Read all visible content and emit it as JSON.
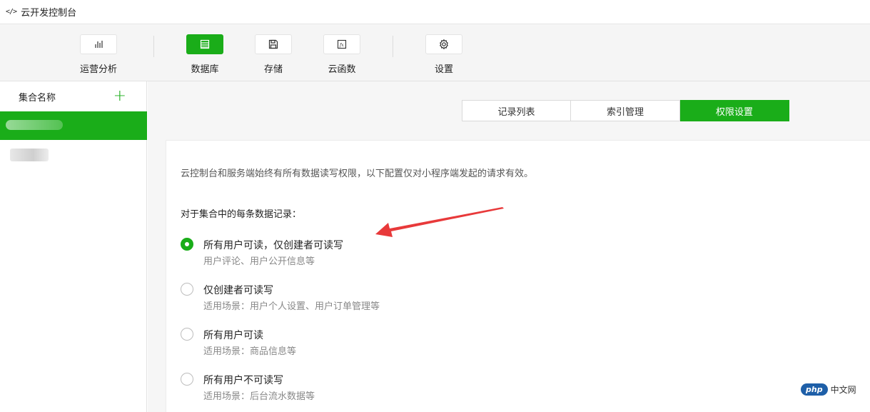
{
  "window": {
    "title": "云开发控制台"
  },
  "toolbar": {
    "items": [
      {
        "label": "运营分析",
        "icon": "bar-chart-icon"
      },
      {
        "label": "数据库",
        "icon": "database-icon",
        "active": true
      },
      {
        "label": "存储",
        "icon": "floppy-disk-icon"
      },
      {
        "label": "云函数",
        "icon": "function-icon"
      },
      {
        "label": "设置",
        "icon": "gear-icon"
      }
    ]
  },
  "sidebar": {
    "header": "集合名称",
    "add": "+"
  },
  "tabs": [
    {
      "label": "记录列表"
    },
    {
      "label": "索引管理"
    },
    {
      "label": "权限设置",
      "active": true
    }
  ],
  "permissions": {
    "description": "云控制台和服务端始终有所有数据读写权限，以下配置仅对小程序端发起的请求有效。",
    "lead": "对于集合中的每条数据记录：",
    "options": [
      {
        "label": "所有用户可读，仅创建者可读写",
        "sub": "用户评论、用户公开信息等",
        "checked": true
      },
      {
        "label": "仅创建者可读写",
        "sub": "适用场景：用户个人设置、用户订单管理等"
      },
      {
        "label": "所有用户可读",
        "sub": "适用场景：商品信息等"
      },
      {
        "label": "所有用户不可读写",
        "sub": "适用场景：后台流水数据等"
      }
    ]
  },
  "watermark": {
    "logo": "php",
    "text": "中文网"
  },
  "colors": {
    "accent": "#1aad19",
    "arrow": "#e8393a"
  }
}
